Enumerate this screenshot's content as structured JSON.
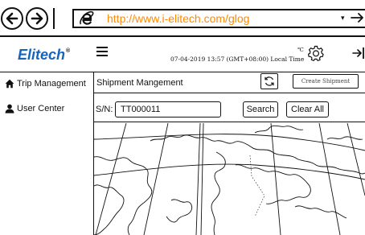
{
  "browser": {
    "url": "http://www.i-elitech.com/glog",
    "icons": {
      "back": "back-arrow-icon",
      "forward": "forward-arrow-icon",
      "browser": "internet-explorer-icon",
      "dropdown": "dropdown-arrow-icon",
      "go": "go-arrow-icon"
    },
    "url_color": "#ff8a00"
  },
  "header": {
    "logo_text": "Elitech",
    "logo_mark": "®",
    "logo_color": "#1565c0",
    "datetime": "07-04-2019 13:57 (GMT+08:00) Local Time",
    "temp_unit": "℃",
    "icons": {
      "menu": "hamburger-menu-icon",
      "settings": "gear-icon",
      "logout": "logout-icon"
    }
  },
  "sidebar": {
    "items": [
      {
        "label": "Trip Management",
        "icon": "home-icon"
      },
      {
        "label": "User Center",
        "icon": "user-icon"
      }
    ]
  },
  "main": {
    "title": "Shipment Mangement",
    "create_button": "Create Shipment",
    "refresh_icon": "refresh-icon",
    "search": {
      "label": "S/N:",
      "value": "TT000011",
      "search_button": "Search",
      "clear_button": "Clear All"
    },
    "map": {
      "type": "world-map-outline"
    }
  }
}
